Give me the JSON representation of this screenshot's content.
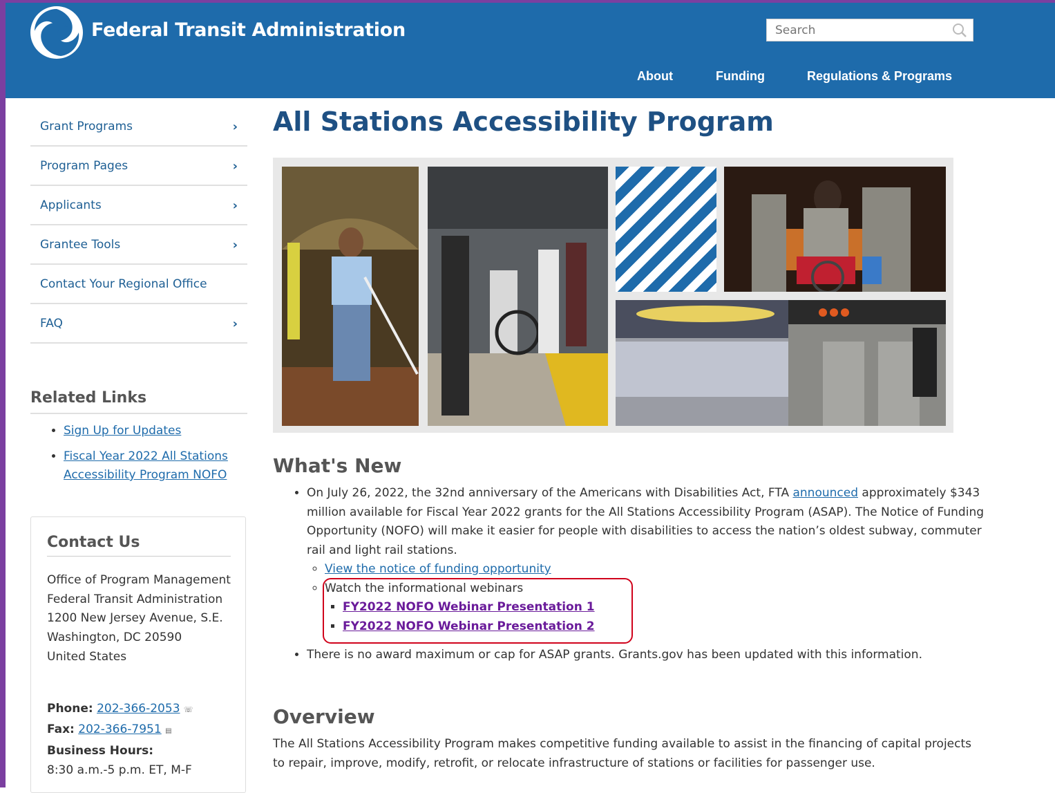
{
  "header": {
    "site_title": "Federal Transit Administration",
    "search_placeholder": "Search",
    "nav": [
      "About",
      "Funding",
      "Regulations & Programs"
    ]
  },
  "sidebar": {
    "items": [
      {
        "label": "Grant Programs",
        "has_chevron": true
      },
      {
        "label": "Program Pages",
        "has_chevron": true
      },
      {
        "label": "Applicants",
        "has_chevron": true
      },
      {
        "label": "Grantee Tools",
        "has_chevron": true
      },
      {
        "label": "Contact Your Regional Office",
        "has_chevron": false
      },
      {
        "label": "FAQ",
        "has_chevron": true
      }
    ],
    "chevron": "›"
  },
  "related": {
    "title": "Related Links",
    "links": [
      "Sign Up for Updates",
      "Fiscal Year 2022 All Stations Accessibility Program NOFO"
    ]
  },
  "contact": {
    "title": "Contact Us",
    "address": [
      "Office of Program Management",
      "Federal Transit Administration",
      "1200 New Jersey Avenue, S.E.",
      "Washington, DC 20590",
      "United States"
    ],
    "phone_label": "Phone:",
    "phone": "202-366-2053",
    "fax_label": "Fax:",
    "fax": "202-366-7951",
    "hours_label": "Business Hours:",
    "hours": "8:30 a.m.-5 p.m. ET, M-F"
  },
  "main": {
    "title": "All Stations Accessibility Program",
    "whats_new_title": "What's New",
    "news1_pre": "On July 26, 2022, the 32nd anniversary of the Americans with Disabilities Act, FTA ",
    "news1_link": "announced",
    "news1_post": " approximately $343 million available for Fiscal Year 2022 grants for the All Stations Accessibility Program (ASAP). The Notice of Funding Opportunity (NOFO) will make it easier for people with disabilities to access the nation’s oldest subway, commuter rail and light rail stations.",
    "nofo_link": "View the notice of funding opportunity",
    "webinars_label": "Watch the informational webinars",
    "webinar1": "FY2022 NOFO Webinar Presentation 1",
    "webinar2": "FY2022 NOFO Webinar Presentation 2",
    "news2": "There is no award maximum or cap for ASAP grants. Grants.gov has been updated with this information.",
    "overview_title": "Overview",
    "overview_text": "The All Stations Accessibility Program makes competitive funding available to assist in the financing of capital projects to repair, improve, modify, retrofit, or relocate infrastructure of stations or facilities for passenger use."
  },
  "colors": {
    "header_bg": "#1e6bab",
    "link": "#1e6bab",
    "title": "#1e5083",
    "highlight": "#d0021b",
    "visited_link": "#6a1b9a"
  }
}
